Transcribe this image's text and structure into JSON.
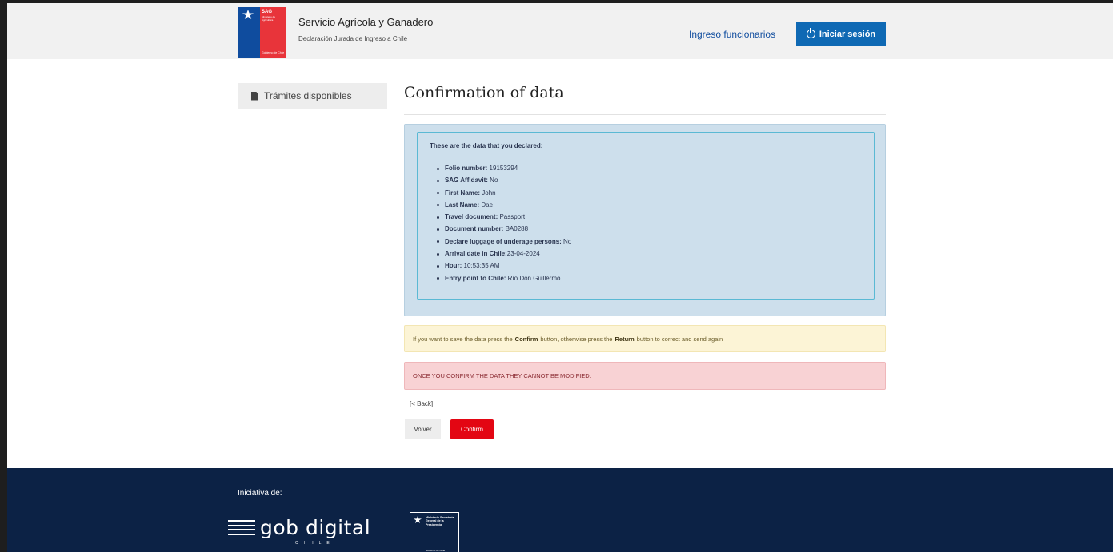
{
  "header": {
    "logo": {
      "sag": "SAG",
      "sag_subtitle": "Ministerio de Agricultura",
      "gobierno": "Gobierno de Chile"
    },
    "title": "Servicio Agrícola y Ganadero",
    "subtitle": "Declaración Jurada de Ingreso a Chile",
    "funcionarios_link": "Ingreso funcionarios",
    "login_button": "Iniciar sesión",
    "login_icon": "power-icon"
  },
  "sidebar": {
    "items": [
      {
        "label": "Trámites disponibles",
        "icon": "document-icon"
      }
    ]
  },
  "main": {
    "title": "Confirmation of data",
    "intro": "These are the data that you declared:",
    "fields": [
      {
        "key": "Folio number:",
        "value": " 19153294"
      },
      {
        "key": "SAG Affidavit:",
        "value": " No"
      },
      {
        "key": "First Name:",
        "value": " John"
      },
      {
        "key": "Last Name:",
        "value": " Dae"
      },
      {
        "key": "Travel document:",
        "value": " Passport"
      },
      {
        "key": "Document number:",
        "value": " BA0288"
      },
      {
        "key": "Declare luggage of underage persons:",
        "value": " No"
      },
      {
        "key": "Arrival date in Chile:",
        "value": "23-04-2024"
      },
      {
        "key": "Hour:",
        "value": " 10:53:35 AM"
      },
      {
        "key": "Entry point to Chile:",
        "value": " Río Don Guillermo"
      }
    ],
    "warning": {
      "part1": "If you want to save the data press the",
      "confirm_word": "Confirm",
      "part2": "button, otherwise press the",
      "return_word": "Return",
      "part3": "button to correct and send again"
    },
    "danger": "ONCE YOU CONFIRM THE DATA THEY CANNOT BE MODIFIED.",
    "back_link": "[< Back]",
    "volver_button": "Volver",
    "confirm_button": "Confirm"
  },
  "footer": {
    "initiative": "Iniciativa de:",
    "gob_digital": "gob digital",
    "gob_chile": "CHILE",
    "ministerio": "Ministerio Secretaría General de la Presidencia",
    "ministerio_bottom": "Gobierno de Chile"
  },
  "colors": {
    "header_bg": "#f1f1f1",
    "primary_blue": "#0f69b4",
    "confirm_red": "#e30613",
    "info_bg": "#cddfec",
    "warning_bg": "#fcf4d6",
    "danger_bg": "#f8d2d4",
    "footer_bg": "#0c2245"
  }
}
